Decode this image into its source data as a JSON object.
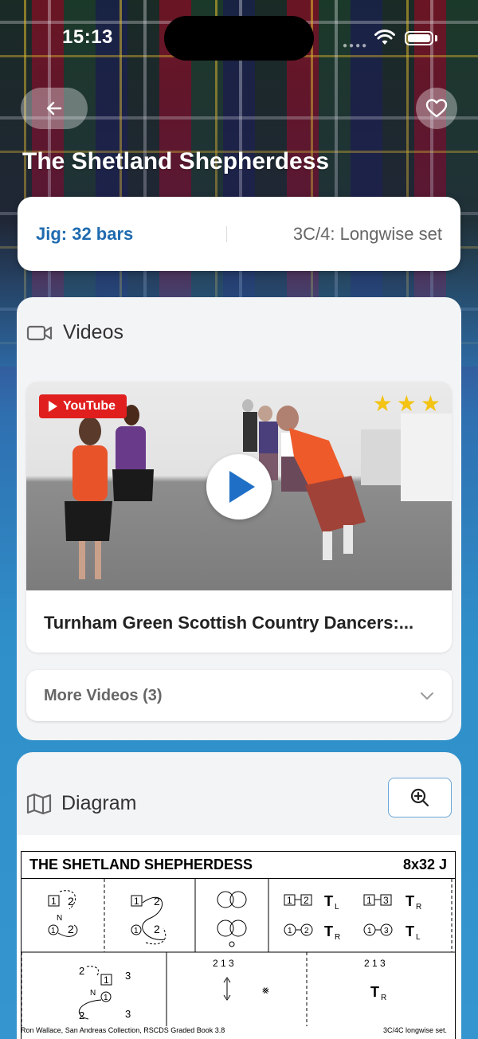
{
  "status": {
    "time": "15:13"
  },
  "nav": {
    "back_icon": "arrow-left-icon",
    "favorite_icon": "heart-icon"
  },
  "dance": {
    "title": "The Shetland Shepherdess",
    "type": "Jig: 32 bars",
    "set": "3C/4: Longwise set"
  },
  "videos": {
    "heading": "Videos",
    "icon": "video-camera-icon",
    "card": {
      "badge": "YouTube",
      "stars": 3,
      "title": "Turnham Green Scottish Country Dancers:..."
    },
    "more_label": "More Videos (3)"
  },
  "diagram": {
    "heading": "Diagram",
    "icon": "map-icon",
    "title": "THE SHETLAND SHEPHERDESS",
    "formation": "8x32 J",
    "numbers_a": "2 1 3",
    "numbers_b": "2 1 3",
    "footer_left": "Ron Wallace, San Andreas Collection, RSCDS Graded Book 3.8",
    "footer_right": "3C/4C longwise set."
  },
  "colors": {
    "accent": "#1f6bb0",
    "youtube": "#e01e1e",
    "star": "#f3c316"
  }
}
